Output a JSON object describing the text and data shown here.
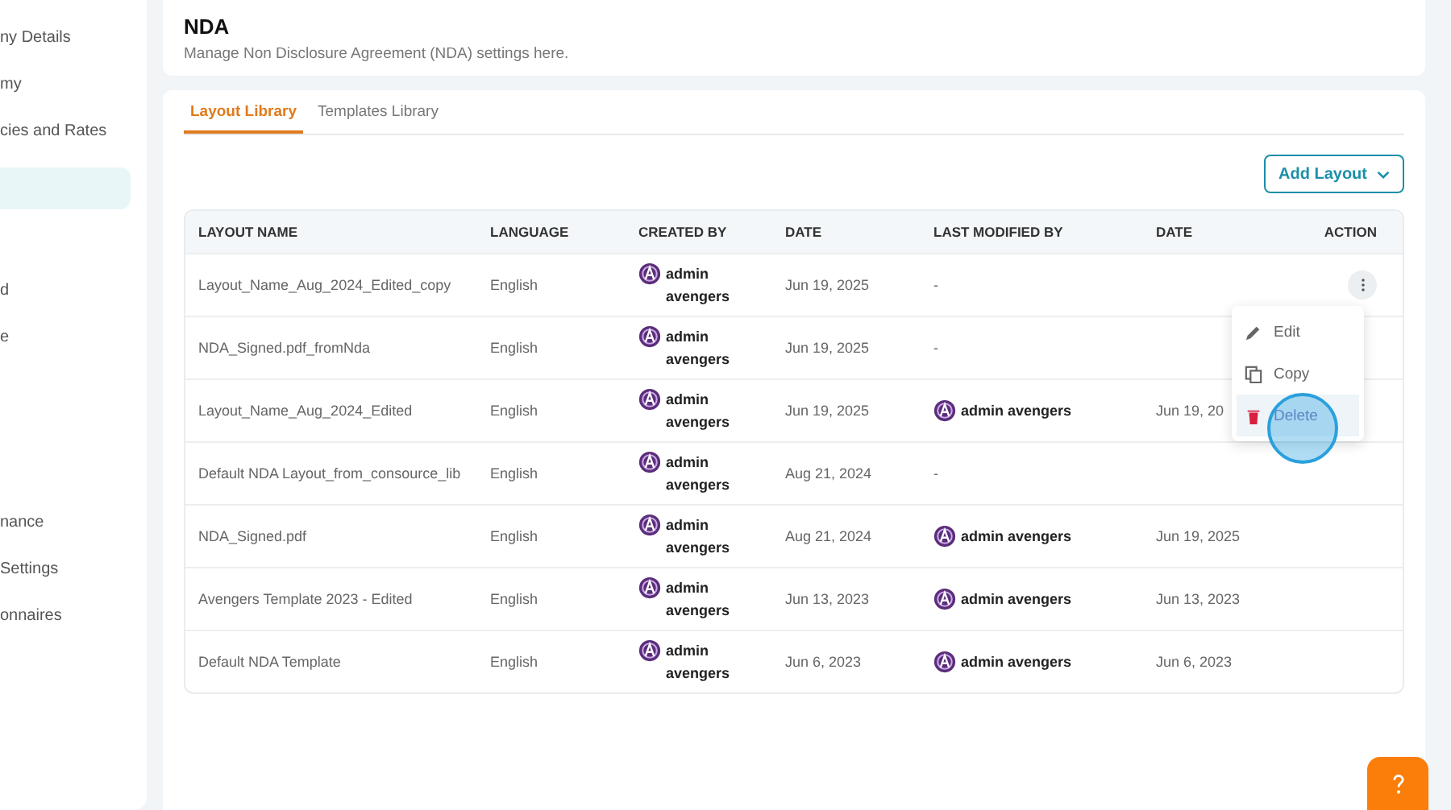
{
  "sidebar": {
    "items": [
      {
        "label": "ny Details",
        "selected": false
      },
      {
        "label": "my",
        "selected": false
      },
      {
        "label": "cies and Rates",
        "selected": false
      },
      {
        "selected": true
      },
      {
        "label": "d",
        "selected": false
      },
      {
        "label": "e",
        "selected": false
      },
      {
        "label": "nance",
        "selected": false
      },
      {
        "label": " Settings",
        "selected": false
      },
      {
        "label": "onnaires",
        "selected": false
      }
    ]
  },
  "header": {
    "title": "NDA",
    "subtitle": "Manage Non Disclosure Agreement (NDA) settings here."
  },
  "tabs": [
    {
      "label": "Layout Library",
      "selected": true
    },
    {
      "label": "Templates Library",
      "selected": false
    }
  ],
  "add_button": {
    "label": "Add Layout"
  },
  "table": {
    "columns": [
      "LAYOUT NAME",
      "LANGUAGE",
      "CREATED BY",
      "DATE",
      "LAST MODIFIED BY",
      "DATE",
      "ACTION"
    ],
    "rows": [
      {
        "name": "Layout_Name_Aug_2024_Edited_copy",
        "language": "English",
        "created_by": "admin avengers",
        "date": "Jun 19, 2025",
        "modified_by": "-",
        "modified_date": "",
        "menu_open": true
      },
      {
        "name": "NDA_Signed.pdf_fromNda",
        "language": "English",
        "created_by": "admin avengers",
        "date": "Jun 19, 2025",
        "modified_by": "-",
        "modified_date": "",
        "menu_open": false
      },
      {
        "name": "Layout_Name_Aug_2024_Edited",
        "language": "English",
        "created_by": "admin avengers",
        "date": "Jun 19, 2025",
        "modified_by": "admin avengers",
        "modified_date": "Jun 19, 20",
        "menu_open": false
      },
      {
        "name": "Default NDA Layout_from_consource_lib",
        "language": "English",
        "created_by": "admin avengers",
        "date": "Aug 21, 2024",
        "modified_by": "-",
        "modified_date": "",
        "menu_open": false
      },
      {
        "name": "NDA_Signed.pdf",
        "language": "English",
        "created_by": "admin avengers",
        "date": "Aug 21, 2024",
        "modified_by": "admin avengers",
        "modified_date": "Jun 19, 2025",
        "menu_open": false
      },
      {
        "name": "Avengers Template 2023 - Edited",
        "language": "English",
        "created_by": "admin avengers",
        "date": "Jun 13, 2023",
        "modified_by": "admin avengers",
        "modified_date": "Jun 13, 2023",
        "menu_open": false
      },
      {
        "name": "Default NDA Template",
        "language": "English",
        "created_by": "admin avengers",
        "date": "Jun 6, 2023",
        "modified_by": "admin avengers",
        "modified_date": "Jun 6, 2023",
        "menu_open": false
      }
    ]
  },
  "action_menu": {
    "items": [
      {
        "kind": "edit",
        "label": "Edit",
        "selected": false
      },
      {
        "kind": "copy",
        "label": "Copy",
        "selected": false
      },
      {
        "kind": "delete",
        "label": "Delete",
        "selected": true
      }
    ]
  }
}
